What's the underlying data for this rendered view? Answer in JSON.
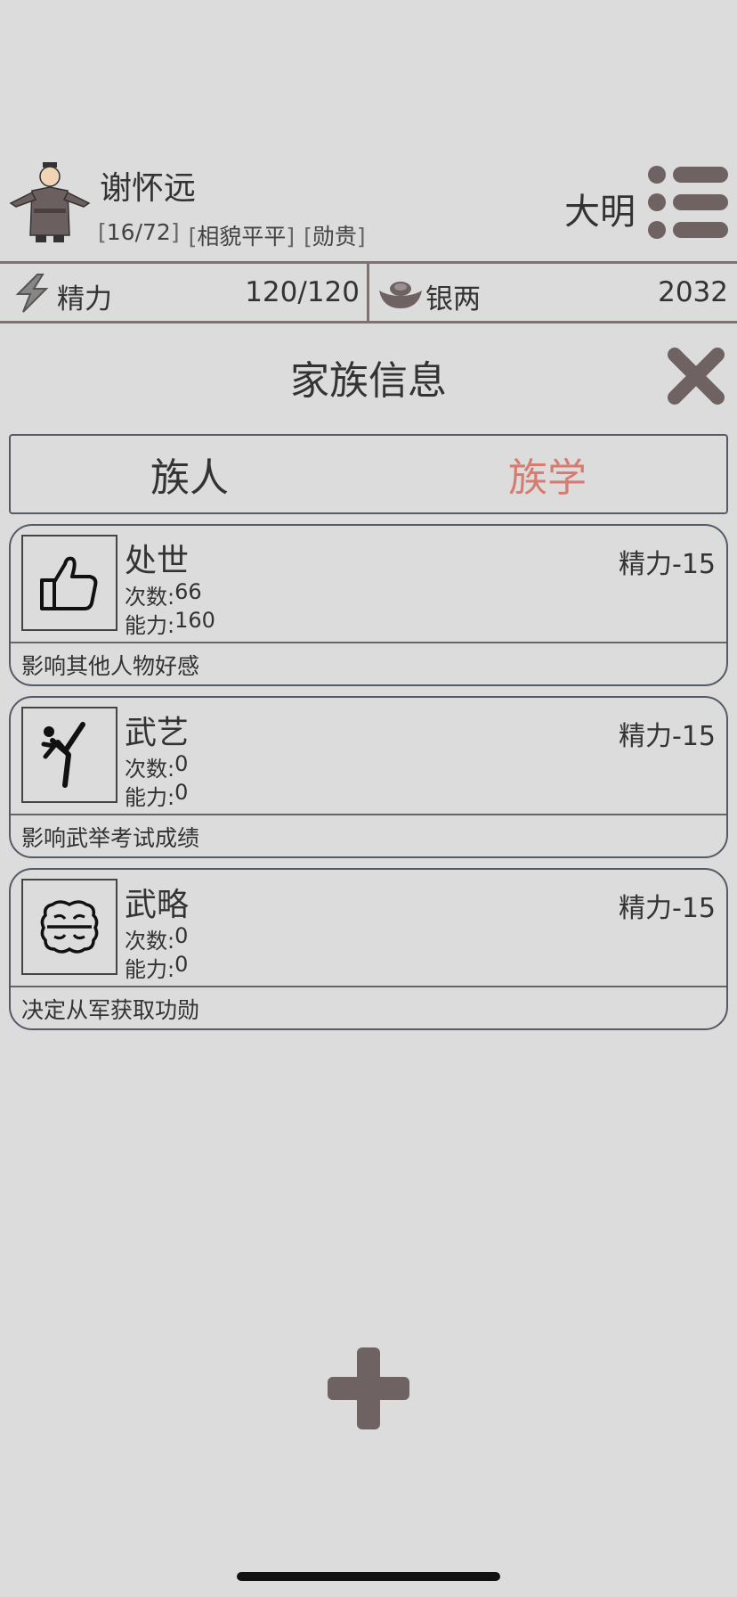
{
  "character": {
    "name": "谢怀远",
    "tags": [
      "16/72",
      "相貌平平",
      "勋贵"
    ],
    "dynasty": "大明"
  },
  "stats": {
    "stamina": {
      "icon": "lightning-icon",
      "label": "精力",
      "value": "120/120"
    },
    "silver": {
      "icon": "silver-ingot-icon",
      "label": "银两",
      "value": "2032"
    }
  },
  "panel": {
    "title": "家族信息",
    "tabs": [
      {
        "label": "族人",
        "active": false
      },
      {
        "label": "族学",
        "active": true
      }
    ]
  },
  "skills": [
    {
      "icon": "thumbs-up-icon",
      "name": "处世",
      "cost": "精力-15",
      "count_label": "次数: ",
      "count": "66",
      "ability_label": "能力: ",
      "ability": "160",
      "desc": "影响其他人物好感"
    },
    {
      "icon": "martial-arts-kick-icon",
      "name": "武艺",
      "cost": "精力-15",
      "count_label": "次数: ",
      "count": "0",
      "ability_label": "能力: ",
      "ability": "0",
      "desc": "影响武举考试成绩"
    },
    {
      "icon": "brain-icon",
      "name": "武略",
      "cost": "精力-15",
      "count_label": "次数: ",
      "count": "0",
      "ability_label": "能力: ",
      "ability": "0",
      "desc": "决定从军获取功勋"
    }
  ],
  "colors": {
    "background": "#dcdcdc",
    "accent_tab": "#d77a6f",
    "button_gray": "#6e6262",
    "border": "#555a66"
  }
}
